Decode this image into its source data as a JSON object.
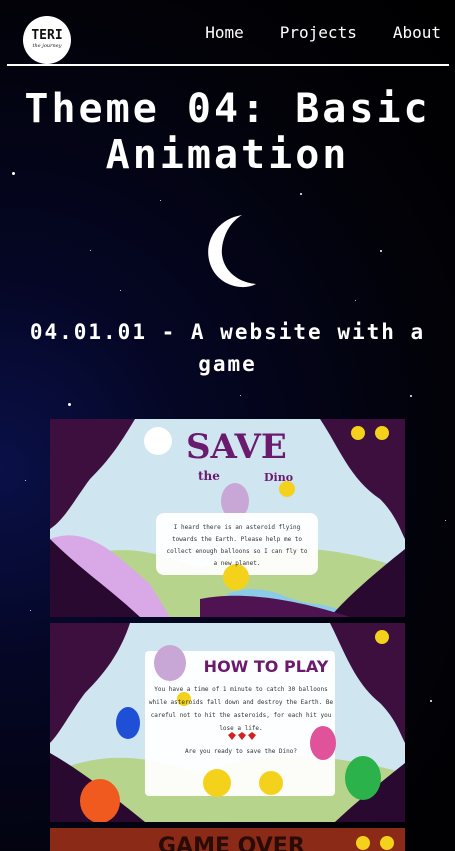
{
  "header": {
    "logo": {
      "title": "TERI",
      "subtitle": "the journey"
    },
    "nav": [
      {
        "label": "Home"
      },
      {
        "label": "Projects"
      },
      {
        "label": "About"
      }
    ]
  },
  "page": {
    "title": "Theme 04: Basic Animation",
    "project_title": "04.01.01 - A website with a game"
  },
  "screenshots": [
    {
      "heading_line1": "SAVE",
      "heading_line2": "the",
      "heading_line3": "Dino",
      "text": "I heard there is an asteroid flying towards the Earth. Please help me to collect enough balloons so I can fly to a new planet."
    },
    {
      "heading": "HOW TO PLAY",
      "text": "You have a time of 1 minute to catch 30 balloons while asteroids fall down and destroy the Earth. Be careful not to hit the asteroids, for each hit you lose a life.",
      "question": "Are you ready to save the Dino?"
    },
    {
      "heading": "GAME OVER"
    }
  ],
  "colors": {
    "background": "#020208",
    "text": "#ffffff",
    "game_heading": "#6a1b6e",
    "balloon_yellow": "#f4d21c"
  }
}
